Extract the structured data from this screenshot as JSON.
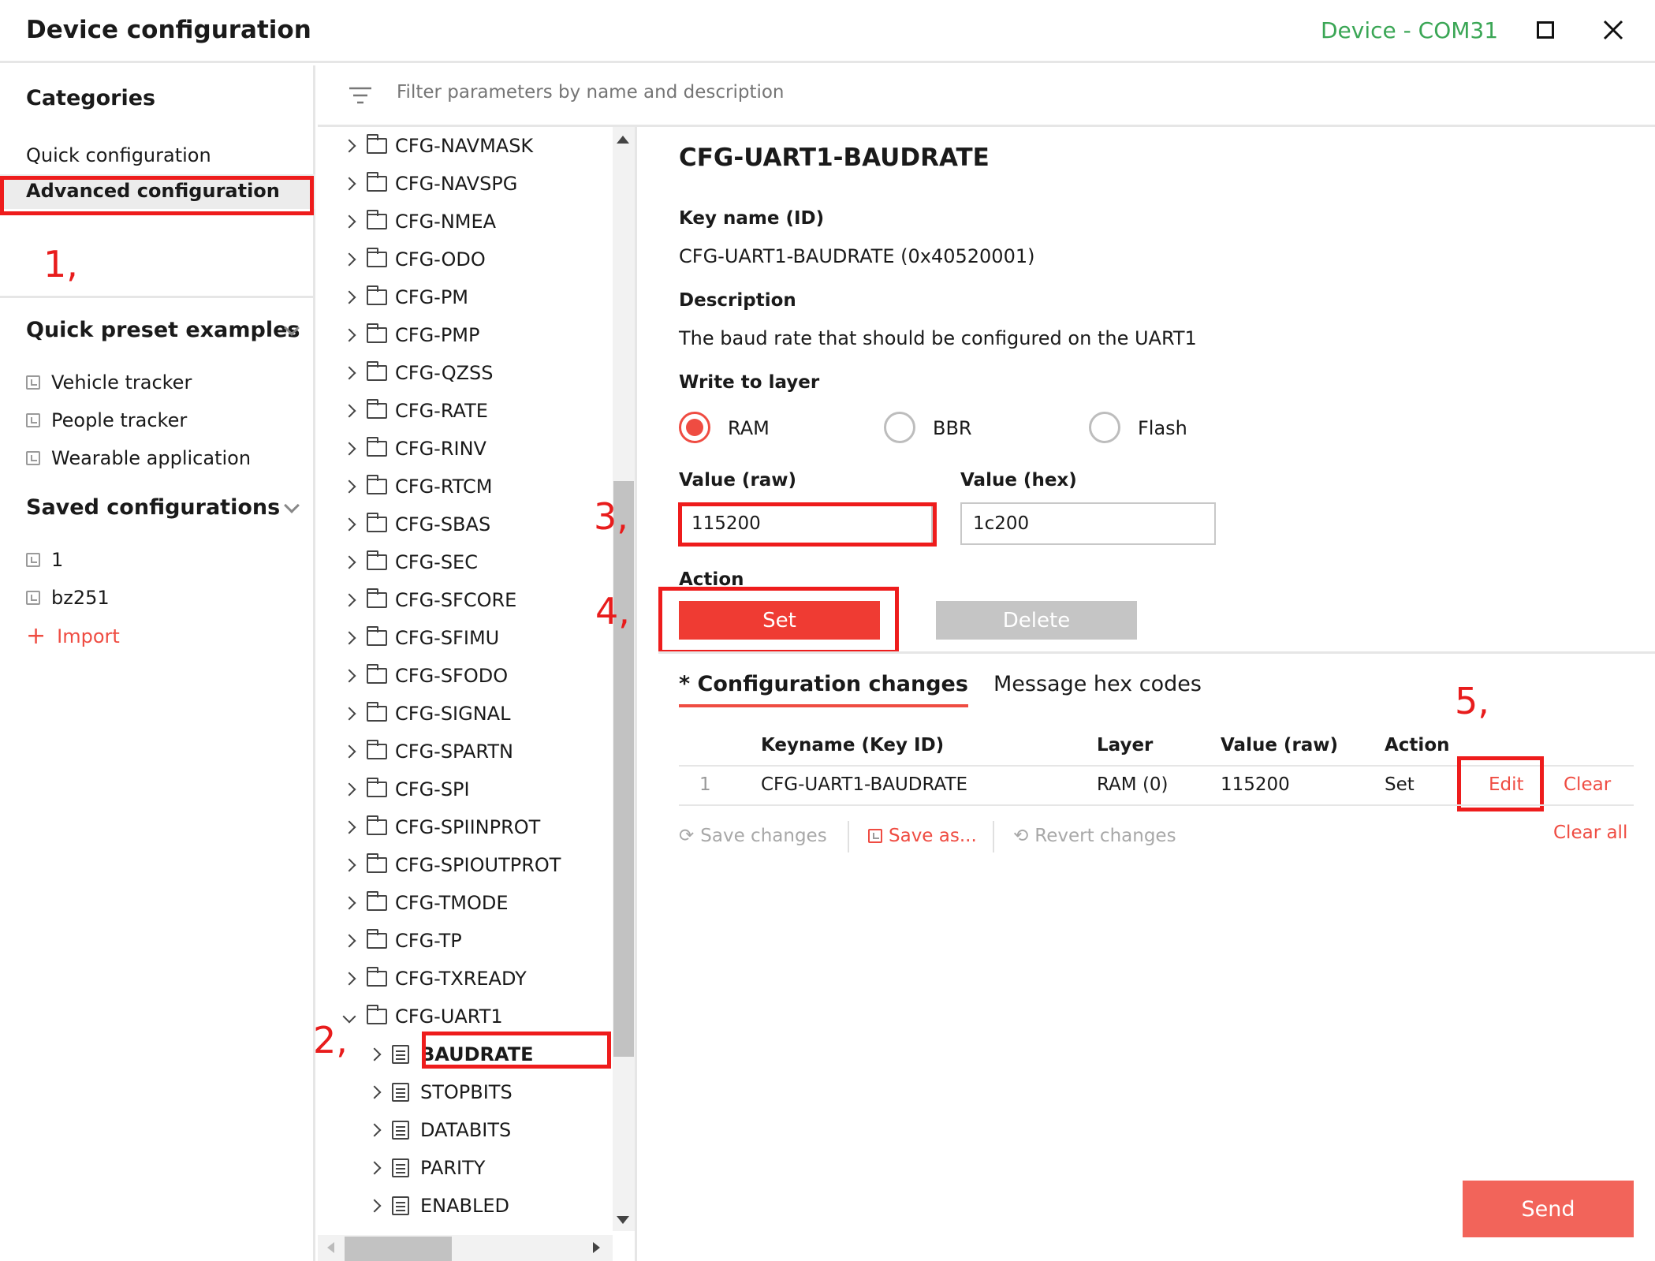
{
  "window": {
    "title": "Device configuration",
    "device": "Device - COM31"
  },
  "categories": {
    "header": "Categories",
    "items": [
      {
        "label": "Quick configuration"
      },
      {
        "label": "Advanced configuration"
      }
    ]
  },
  "presets": {
    "header": "Quick preset examples",
    "items": [
      {
        "label": "Vehicle tracker"
      },
      {
        "label": "People tracker"
      },
      {
        "label": "Wearable application"
      }
    ]
  },
  "saved": {
    "header": "Saved configurations",
    "items": [
      {
        "label": "1"
      },
      {
        "label": "bz251"
      }
    ],
    "import_label": "Import"
  },
  "filter": {
    "placeholder": "Filter parameters by name and description"
  },
  "tree": {
    "groups": [
      "CFG-NAVMASK",
      "CFG-NAVSPG",
      "CFG-NMEA",
      "CFG-ODO",
      "CFG-PM",
      "CFG-PMP",
      "CFG-QZSS",
      "CFG-RATE",
      "CFG-RINV",
      "CFG-RTCM",
      "CFG-SBAS",
      "CFG-SEC",
      "CFG-SFCORE",
      "CFG-SFIMU",
      "CFG-SFODO",
      "CFG-SIGNAL",
      "CFG-SPARTN",
      "CFG-SPI",
      "CFG-SPIINPROT",
      "CFG-SPIOUTPROT",
      "CFG-TMODE",
      "CFG-TP",
      "CFG-TXREADY",
      "CFG-UART1"
    ],
    "children": [
      "BAUDRATE",
      "STOPBITS",
      "DATABITS",
      "PARITY",
      "ENABLED"
    ],
    "selected": "BAUDRATE"
  },
  "detail": {
    "title": "CFG-UART1-BAUDRATE",
    "key_label": "Key name (ID)",
    "key_value": "CFG-UART1-BAUDRATE (0x40520001)",
    "desc_label": "Description",
    "desc_value": "The baud rate that should be configured on the UART1",
    "layer_label": "Write to layer",
    "layers": [
      "RAM",
      "BBR",
      "Flash"
    ],
    "selected_layer": "RAM",
    "raw_label": "Value (raw)",
    "raw_value": "115200",
    "hex_label": "Value (hex)",
    "hex_value": "1c200",
    "action_label": "Action",
    "set_label": "Set",
    "delete_label": "Delete"
  },
  "changes": {
    "tab_active": "* Configuration changes",
    "tab_other": "Message hex codes",
    "columns": [
      "Keyname (Key ID)",
      "Layer",
      "Value (raw)",
      "Action"
    ],
    "rows": [
      {
        "index": "1",
        "key": "CFG-UART1-BAUDRATE",
        "layer": "RAM (0)",
        "value": "115200",
        "action": "Set",
        "edit": "Edit",
        "clear": "Clear"
      }
    ],
    "save_changes": "Save changes",
    "save_as": "Save as...",
    "revert": "Revert changes",
    "clear_all": "Clear all"
  },
  "send_label": "Send",
  "annotations": [
    "1,",
    "2,",
    "3,",
    "4,",
    "5,"
  ],
  "colors": {
    "accent": "#ef4c42",
    "device_green": "#3aa655",
    "annotation_red": "#ee1c1c"
  }
}
